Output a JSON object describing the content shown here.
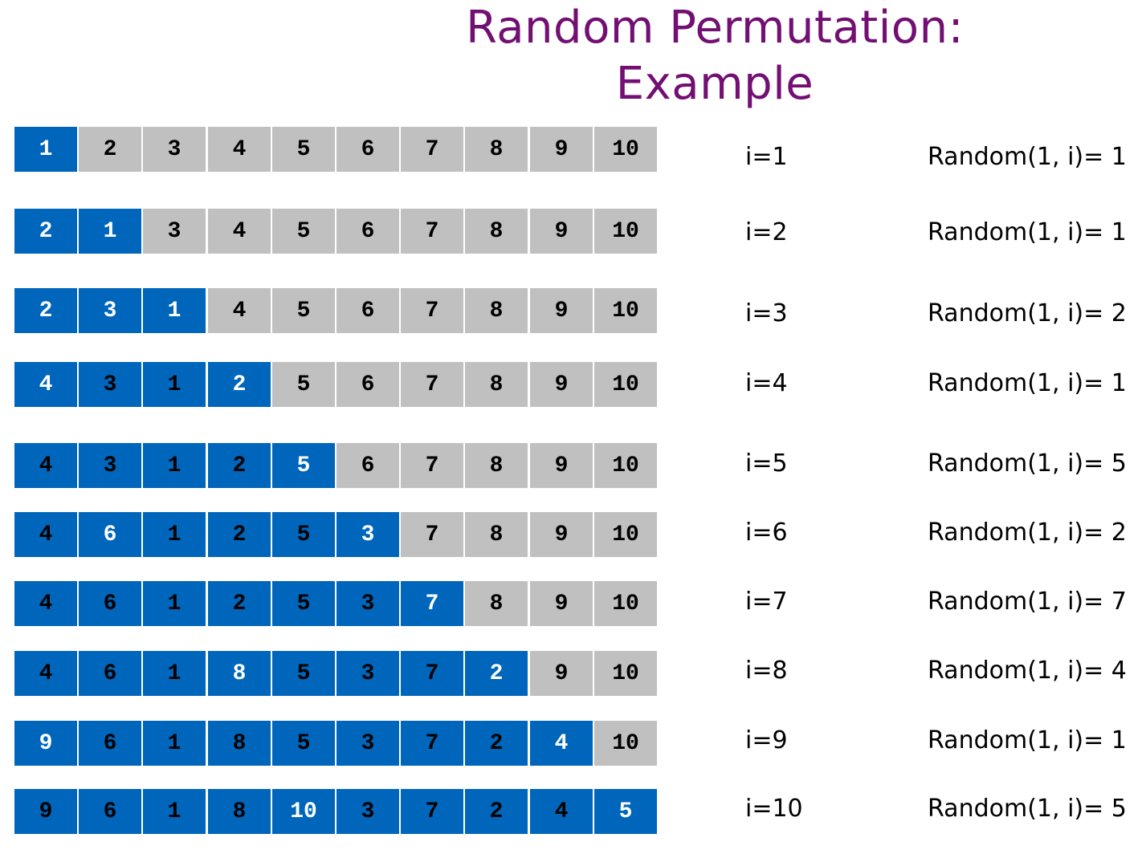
{
  "title": "Random Permutation: Example",
  "colors": {
    "title": "#720F72",
    "filled": "#0066BB",
    "unfilled": "#C0C0C0"
  },
  "rows": [
    {
      "i_label": "i=1",
      "random_label": "Random(1, i)= 1",
      "cells": [
        "1",
        "2",
        "3",
        "4",
        "5",
        "6",
        "7",
        "8",
        "9",
        "10"
      ],
      "filled": 1,
      "white_text": [
        0
      ]
    },
    {
      "i_label": "i=2",
      "random_label": "Random(1, i)= 1",
      "cells": [
        "2",
        "1",
        "3",
        "4",
        "5",
        "6",
        "7",
        "8",
        "9",
        "10"
      ],
      "filled": 2,
      "white_text": [
        0,
        1
      ]
    },
    {
      "i_label": "i=3",
      "random_label": "Random(1, i)= 2",
      "cells": [
        "2",
        "3",
        "1",
        "4",
        "5",
        "6",
        "7",
        "8",
        "9",
        "10"
      ],
      "filled": 3,
      "white_text": [
        0,
        1,
        2
      ]
    },
    {
      "i_label": "i=4",
      "random_label": "Random(1, i)= 1",
      "cells": [
        "4",
        "3",
        "1",
        "2",
        "5",
        "6",
        "7",
        "8",
        "9",
        "10"
      ],
      "filled": 4,
      "white_text": [
        0,
        3
      ]
    },
    {
      "i_label": "i=5",
      "random_label": "Random(1, i)= 5",
      "cells": [
        "4",
        "3",
        "1",
        "2",
        "5",
        "6",
        "7",
        "8",
        "9",
        "10"
      ],
      "filled": 5,
      "white_text": [
        4
      ]
    },
    {
      "i_label": "i=6",
      "random_label": "Random(1, i)= 2",
      "cells": [
        "4",
        "6",
        "1",
        "2",
        "5",
        "3",
        "7",
        "8",
        "9",
        "10"
      ],
      "filled": 6,
      "white_text": [
        1,
        5
      ]
    },
    {
      "i_label": "i=7",
      "random_label": "Random(1, i)= 7",
      "cells": [
        "4",
        "6",
        "1",
        "2",
        "5",
        "3",
        "7",
        "8",
        "9",
        "10"
      ],
      "filled": 7,
      "white_text": [
        6
      ]
    },
    {
      "i_label": "i=8",
      "random_label": "Random(1, i)= 4",
      "cells": [
        "4",
        "6",
        "1",
        "8",
        "5",
        "3",
        "7",
        "2",
        "9",
        "10"
      ],
      "filled": 8,
      "white_text": [
        3,
        7
      ]
    },
    {
      "i_label": "i=9",
      "random_label": "Random(1, i)= 1",
      "cells": [
        "9",
        "6",
        "1",
        "8",
        "5",
        "3",
        "7",
        "2",
        "4",
        "10"
      ],
      "filled": 9,
      "white_text": [
        0,
        8
      ]
    },
    {
      "i_label": "i=10",
      "random_label": "Random(1, i)= 5",
      "cells": [
        "9",
        "6",
        "1",
        "8",
        "10",
        "3",
        "7",
        "2",
        "4",
        "5"
      ],
      "filled": 10,
      "white_text": [
        4,
        9
      ]
    }
  ]
}
